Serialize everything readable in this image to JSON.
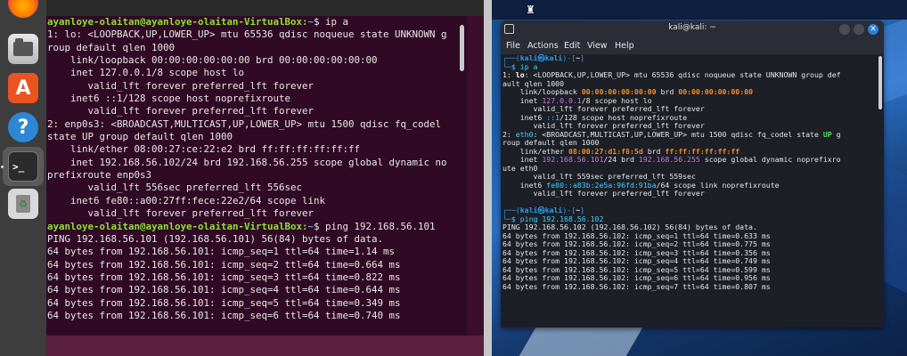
{
  "ubuntu": {
    "dock": {
      "files_label": "",
      "store_glyph": "A",
      "help_glyph": "?",
      "terminal_glyph": ">_",
      "trash_glyph": "♻"
    },
    "terminal": {
      "lines": [
        {
          "prompt": "ayanloye-olaitan@ayanloye-olaitan-VirtualBox",
          "path": "~",
          "cmd": "$ ip a"
        },
        {
          "text": "1: lo: <LOOPBACK,UP,LOWER_UP> mtu 65536 qdisc noqueue state UNKNOWN g"
        },
        {
          "text": "roup default qlen 1000"
        },
        {
          "text": "    link/loopback 00:00:00:00:00:00 brd 00:00:00:00:00:00"
        },
        {
          "text": "    inet 127.0.0.1/8 scope host lo"
        },
        {
          "text": "       valid_lft forever preferred_lft forever"
        },
        {
          "text": "    inet6 ::1/128 scope host noprefixroute"
        },
        {
          "text": "       valid_lft forever preferred_lft forever"
        },
        {
          "text": "2: enp0s3: <BROADCAST,MULTICAST,UP,LOWER_UP> mtu 1500 qdisc fq_codel"
        },
        {
          "text": "state UP group default qlen 1000"
        },
        {
          "text": "    link/ether 08:00:27:ce:22:e2 brd ff:ff:ff:ff:ff:ff"
        },
        {
          "text": "    inet 192.168.56.102/24 brd 192.168.56.255 scope global dynamic no"
        },
        {
          "text": "prefixroute enp0s3"
        },
        {
          "text": "       valid_lft 556sec preferred_lft 556sec"
        },
        {
          "text": "    inet6 fe80::a00:27ff:fece:22e2/64 scope link"
        },
        {
          "text": "       valid_lft forever preferred_lft forever"
        },
        {
          "prompt": "ayanloye-olaitan@ayanloye-olaitan-VirtualBox",
          "path": "~",
          "cmd": "$ ping 192.168.56.101"
        },
        {
          "text": "PING 192.168.56.101 (192.168.56.101) 56(84) bytes of data."
        },
        {
          "text": "64 bytes from 192.168.56.101: icmp_seq=1 ttl=64 time=1.14 ms"
        },
        {
          "text": "64 bytes from 192.168.56.101: icmp_seq=2 ttl=64 time=0.664 ms"
        },
        {
          "text": "64 bytes from 192.168.56.101: icmp_seq=3 ttl=64 time=0.822 ms"
        },
        {
          "text": "64 bytes from 192.168.56.101: icmp_seq=4 ttl=64 time=0.644 ms"
        },
        {
          "text": "64 bytes from 192.168.56.101: icmp_seq=5 ttl=64 time=0.349 ms"
        },
        {
          "text": "64 bytes from 192.168.56.101: icmp_seq=6 ttl=64 time=0.740 ms"
        }
      ]
    }
  },
  "kali": {
    "window_title": "kali@kali: ~",
    "menu": [
      "File",
      "Actions",
      "Edit",
      "View",
      "Help"
    ],
    "terminal": {
      "lines": [
        [
          {
            "t": "┌──(",
            "c": "k-bracket"
          },
          {
            "t": "kali㉿kali",
            "c": "k-user"
          },
          {
            "t": ")-[",
            "c": "k-bracket"
          },
          {
            "t": "~",
            "c": "k-dir"
          },
          {
            "t": "]",
            "c": "k-bracket"
          }
        ],
        [
          {
            "t": "└─",
            "c": "k-bracket"
          },
          {
            "t": "$ ",
            "c": "k-blue"
          },
          {
            "t": "ip a",
            "c": "k-cmd"
          }
        ],
        [
          {
            "t": "1: "
          },
          {
            "t": "lo",
            "c": "k-bold"
          },
          {
            "t": ": <LOOPBACK,UP,LOWER_UP> mtu 65536 qdisc noqueue state UNKNOWN group def"
          }
        ],
        [
          {
            "t": "ault qlen 1000"
          }
        ],
        [
          {
            "t": "    link/loopback "
          },
          {
            "t": "00:00:00:00:00:00",
            "c": "k-orange"
          },
          {
            "t": " brd "
          },
          {
            "t": "00:00:00:00:00:00",
            "c": "k-orange"
          }
        ],
        [
          {
            "t": "    inet "
          },
          {
            "t": "127.0.0.1",
            "c": "k-purple"
          },
          {
            "t": "/8 scope host lo"
          }
        ],
        [
          {
            "t": "       valid_lft forever preferred_lft forever"
          }
        ],
        [
          {
            "t": "    inet6 "
          },
          {
            "t": "::1",
            "c": "k-cmd"
          },
          {
            "t": "/128 scope host noprefixroute"
          }
        ],
        [
          {
            "t": "       valid_lft forever preferred_lft forever"
          }
        ],
        [
          {
            "t": "2: "
          },
          {
            "t": "eth0",
            "c": "k-cmd"
          },
          {
            "t": ": <BROADCAST,MULTICAST,UP,LOWER_UP> mtu 1500 qdisc fq_codel state "
          },
          {
            "t": "UP",
            "c": "k-green"
          },
          {
            "t": " g"
          }
        ],
        [
          {
            "t": "roup default qlen 1000"
          }
        ],
        [
          {
            "t": "    link/ether "
          },
          {
            "t": "08:00:27:d1:f8:5d",
            "c": "k-orange"
          },
          {
            "t": " brd "
          },
          {
            "t": "ff:ff:ff:ff:ff:ff",
            "c": "k-orange"
          }
        ],
        [
          {
            "t": "    inet "
          },
          {
            "t": "192.168.56.101",
            "c": "k-purple"
          },
          {
            "t": "/24 brd "
          },
          {
            "t": "192.168.56.255",
            "c": "k-purple"
          },
          {
            "t": " scope global dynamic noprefixro"
          }
        ],
        [
          {
            "t": "ute eth0"
          }
        ],
        [
          {
            "t": "       valid_lft 559sec preferred_lft 559sec"
          }
        ],
        [
          {
            "t": "    inet6 "
          },
          {
            "t": "fe80::a83b:2e5a:96fd:91ba",
            "c": "k-cmd"
          },
          {
            "t": "/64 scope link noprefixroute"
          }
        ],
        [
          {
            "t": "       valid_lft forever preferred_lft forever"
          }
        ],
        [
          {
            "t": ""
          }
        ],
        [
          {
            "t": "┌──(",
            "c": "k-bracket"
          },
          {
            "t": "kali㉿kali",
            "c": "k-user"
          },
          {
            "t": ")-[",
            "c": "k-bracket"
          },
          {
            "t": "~",
            "c": "k-dir"
          },
          {
            "t": "]",
            "c": "k-bracket"
          }
        ],
        [
          {
            "t": "└─",
            "c": "k-bracket"
          },
          {
            "t": "$ ",
            "c": "k-blue"
          },
          {
            "t": "ping 192.168.56.102",
            "c": "k-cmd"
          }
        ],
        [
          {
            "t": "PING 192.168.56.102 (192.168.56.102) 56(84) bytes of data."
          }
        ],
        [
          {
            "t": "64 bytes from 192.168.56.102: icmp_seq=1 ttl=64 time=0.633 ms"
          }
        ],
        [
          {
            "t": "64 bytes from 192.168.56.102: icmp_seq=2 ttl=64 time=0.775 ms"
          }
        ],
        [
          {
            "t": "64 bytes from 192.168.56.102: icmp_seq=3 ttl=64 time=0.356 ms"
          }
        ],
        [
          {
            "t": "64 bytes from 192.168.56.102: icmp_seq=4 ttl=64 time=0.749 ms"
          }
        ],
        [
          {
            "t": "64 bytes from 192.168.56.102: icmp_seq=5 ttl=64 time=0.599 ms"
          }
        ],
        [
          {
            "t": "64 bytes from 192.168.56.102: icmp_seq=6 ttl=64 time=0.956 ms"
          }
        ],
        [
          {
            "t": "64 bytes from 192.168.56.102: icmp_seq=7 ttl=64 time=0.807 ms"
          }
        ]
      ]
    }
  }
}
